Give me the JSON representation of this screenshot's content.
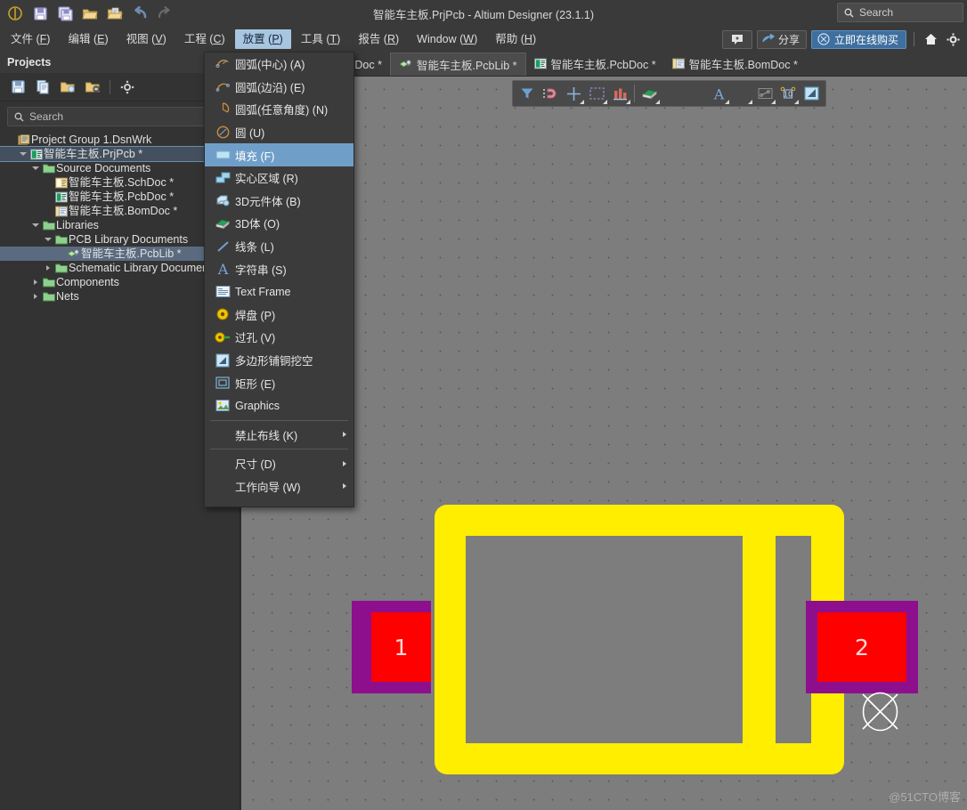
{
  "window": {
    "title": "智能车主板.PrjPcb - Altium Designer (23.1.1)",
    "search_placeholder": "Search"
  },
  "quick_toolbar": [
    {
      "name": "save-icon",
      "label": "保存"
    },
    {
      "name": "save-all-icon",
      "label": "全部保存"
    },
    {
      "name": "open-folder-icon",
      "label": "打开"
    },
    {
      "name": "open-document-icon",
      "label": "打开文档"
    },
    {
      "name": "undo-icon",
      "label": "撤销"
    },
    {
      "name": "redo-icon",
      "label": "重做"
    }
  ],
  "menubar": {
    "items": [
      {
        "label": "文件",
        "accel": "F",
        "active": false
      },
      {
        "label": "编辑",
        "accel": "E",
        "active": false
      },
      {
        "label": "视图",
        "accel": "V",
        "active": false
      },
      {
        "label": "工程",
        "accel": "C",
        "active": false
      },
      {
        "label": "放置",
        "accel": "P",
        "active": true
      },
      {
        "label": "工具",
        "accel": "T",
        "active": false
      },
      {
        "label": "报告",
        "accel": "R",
        "active": false
      },
      {
        "label": "Window",
        "accel": "W",
        "active": false
      },
      {
        "label": "帮助",
        "accel": "H",
        "active": false
      }
    ],
    "right": {
      "notify_label": "",
      "share_label": "分享",
      "buy_label": "立即在线购买",
      "home_label": "主页",
      "settings_label": "设置"
    }
  },
  "panel": {
    "title": "Projects",
    "search_placeholder": "Search",
    "tools": [
      {
        "name": "panel-save-icon",
        "label": "保存"
      },
      {
        "name": "panel-copy-icon",
        "label": "复制"
      },
      {
        "name": "panel-open-project-icon",
        "label": "打开工程"
      },
      {
        "name": "panel-close-project-icon",
        "label": "关闭工程"
      },
      {
        "name": "panel-settings-icon",
        "label": "设置"
      }
    ],
    "tree": [
      {
        "label": "Project Group 1.DsnWrk",
        "indent": 0,
        "icon": "workspace-icon",
        "twisty": "none",
        "selected": "",
        "bracket": ""
      },
      {
        "label": "智能车主板.PrjPcb *",
        "indent": 1,
        "icon": "pcb-project-icon",
        "twisty": "open",
        "selected": "sel1",
        "bracket": "["
      },
      {
        "label": "Source Documents",
        "indent": 2,
        "icon": "folder-icon",
        "twisty": "open",
        "selected": "",
        "bracket": ""
      },
      {
        "label": "智能车主板.SchDoc *",
        "indent": 3,
        "icon": "sch-doc-icon",
        "twisty": "none",
        "selected": "",
        "bracket": "["
      },
      {
        "label": "智能车主板.PcbDoc *",
        "indent": 3,
        "icon": "pcb-doc-icon",
        "twisty": "none",
        "selected": "",
        "bracket": "["
      },
      {
        "label": "智能车主板.BomDoc *",
        "indent": 3,
        "icon": "bom-doc-icon",
        "twisty": "none",
        "selected": "",
        "bracket": "["
      },
      {
        "label": "Libraries",
        "indent": 2,
        "icon": "folder-icon",
        "twisty": "open",
        "selected": "",
        "bracket": ""
      },
      {
        "label": "PCB Library Documents",
        "indent": 3,
        "icon": "folder-icon",
        "twisty": "open",
        "selected": "",
        "bracket": ""
      },
      {
        "label": "智能车主板.PcbLib *",
        "indent": 4,
        "icon": "pcblib-icon",
        "twisty": "none",
        "selected": "sel2",
        "bracket": "["
      },
      {
        "label": "Schematic Library Documents",
        "indent": 3,
        "icon": "folder-icon",
        "twisty": "closed",
        "selected": "",
        "bracket": ""
      },
      {
        "label": "Components",
        "indent": 2,
        "icon": "folder-icon",
        "twisty": "closed",
        "selected": "",
        "bracket": ""
      },
      {
        "label": "Nets",
        "indent": 2,
        "icon": "folder-icon",
        "twisty": "closed",
        "selected": "",
        "bracket": ""
      }
    ]
  },
  "place_menu": {
    "items": [
      {
        "label": "圆弧(中心) (A)",
        "icon": "arc-center-icon",
        "type": "item",
        "highlight": false,
        "submenu": false
      },
      {
        "label": "圆弧(边沿) (E)",
        "icon": "arc-edge-icon",
        "type": "item",
        "highlight": false,
        "submenu": false
      },
      {
        "label": "圆弧(任意角度) (N)",
        "icon": "arc-any-angle-icon",
        "type": "item",
        "highlight": false,
        "submenu": false
      },
      {
        "label": "圆 (U)",
        "icon": "circle-icon",
        "type": "item",
        "highlight": false,
        "submenu": false
      },
      {
        "label": "填充 (F)",
        "icon": "fill-icon",
        "type": "item",
        "highlight": true,
        "submenu": false
      },
      {
        "label": "实心区域 (R)",
        "icon": "solid-region-icon",
        "type": "item",
        "highlight": false,
        "submenu": false
      },
      {
        "label": "3D元件体 (B)",
        "icon": "3d-component-body-icon",
        "type": "item",
        "highlight": false,
        "submenu": false
      },
      {
        "label": "3D体 (O)",
        "icon": "3d-body-icon",
        "type": "item",
        "highlight": false,
        "submenu": false
      },
      {
        "label": "线条 (L)",
        "icon": "line-icon",
        "type": "item",
        "highlight": false,
        "submenu": false
      },
      {
        "label": "字符串 (S)",
        "icon": "string-icon",
        "type": "item",
        "highlight": false,
        "submenu": false
      },
      {
        "label": "Text Frame",
        "icon": "text-frame-icon",
        "type": "item",
        "highlight": false,
        "submenu": false
      },
      {
        "label": "焊盘 (P)",
        "icon": "pad-icon",
        "type": "item",
        "highlight": false,
        "submenu": false
      },
      {
        "label": "过孔 (V)",
        "icon": "via-icon",
        "type": "item",
        "highlight": false,
        "submenu": false
      },
      {
        "label": "多边形铺铜挖空",
        "icon": "polygon-cutout-icon",
        "type": "item",
        "highlight": false,
        "submenu": false
      },
      {
        "label": "矩形 (E)",
        "icon": "rectangle-icon",
        "type": "item",
        "highlight": false,
        "submenu": false
      },
      {
        "label": "Graphics",
        "icon": "graphics-icon",
        "type": "item",
        "highlight": false,
        "submenu": false
      },
      {
        "label": "",
        "icon": "",
        "type": "separator",
        "highlight": false,
        "submenu": false
      },
      {
        "label": "禁止布线 (K)",
        "icon": "",
        "type": "item",
        "highlight": false,
        "submenu": true
      },
      {
        "label": "",
        "icon": "",
        "type": "separator",
        "highlight": false,
        "submenu": false
      },
      {
        "label": "尺寸 (D)",
        "icon": "",
        "type": "item",
        "highlight": false,
        "submenu": true
      },
      {
        "label": "工作向导 (W)",
        "icon": "",
        "type": "item",
        "highlight": false,
        "submenu": true
      }
    ]
  },
  "doc_tabs": [
    {
      "label": "智能车主板.SchDoc *",
      "icon": "sch-doc-icon",
      "active": false
    },
    {
      "label": "智能车主板.PcbLib *",
      "icon": "pcblib-icon",
      "active": true
    },
    {
      "label": "智能车主板.PcbDoc *",
      "icon": "pcb-doc-icon",
      "active": false
    },
    {
      "label": "智能车主板.BomDoc *",
      "icon": "bom-doc-icon",
      "active": false
    }
  ],
  "pcb_toolbar": [
    {
      "name": "filter-icon",
      "dropdown": false
    },
    {
      "name": "magnet-snap-icon",
      "dropdown": false
    },
    {
      "name": "crosshair-place-icon",
      "dropdown": true
    },
    {
      "name": "select-area-icon",
      "dropdown": true
    },
    {
      "name": "align-icon",
      "dropdown": true
    },
    {
      "name": "component-body-icon",
      "dropdown": true
    },
    {
      "name": "pad-icon",
      "dropdown": false
    },
    {
      "name": "via-icon",
      "dropdown": false
    },
    {
      "name": "text-string-icon",
      "dropdown": true
    },
    {
      "name": "line-icon",
      "dropdown": true
    },
    {
      "name": "dimension-icon",
      "dropdown": true
    },
    {
      "name": "coordinate-icon",
      "dropdown": true
    },
    {
      "name": "polygon-pour-icon",
      "dropdown": false
    }
  ],
  "footprint": {
    "pad1_label": "1",
    "pad2_label": "2",
    "silk_color": "#ffee00",
    "pad_top_color": "#8e0f8e",
    "pad_copper_color": "#ff0000",
    "background_color": "#7d7d7d",
    "origin_marker": "crosshair-circle"
  },
  "watermark": "@51CTO博客"
}
